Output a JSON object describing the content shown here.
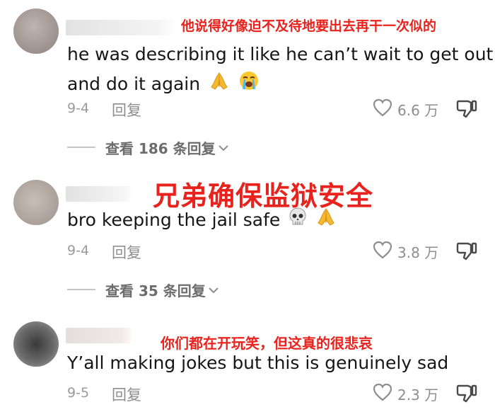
{
  "comments": [
    {
      "translation": "他说得好像迫不及待地要出去再干一次似的",
      "text": "he was describing it like he can’t wait to get out",
      "text2": "and do it again",
      "emojis": [
        "folded-hands",
        "loudly-crying-face"
      ],
      "date": "9-4",
      "reply_label": "回复",
      "likes": "6.6 万",
      "view_replies": "查看 186 条回复"
    },
    {
      "translation": "兄弟确保监狱安全",
      "text": "bro keeping the jail safe",
      "emojis": [
        "skull",
        "folded-hands"
      ],
      "date": "9-4",
      "reply_label": "回复",
      "likes": "3.8 万",
      "view_replies": "查看 35 条回复"
    },
    {
      "translation": "你们都在开玩笑，但这真的很悲哀",
      "text": "Y’all making jokes but this is genuinely sad",
      "date": "9-5",
      "reply_label": "回复",
      "likes": "2.3 万"
    }
  ]
}
